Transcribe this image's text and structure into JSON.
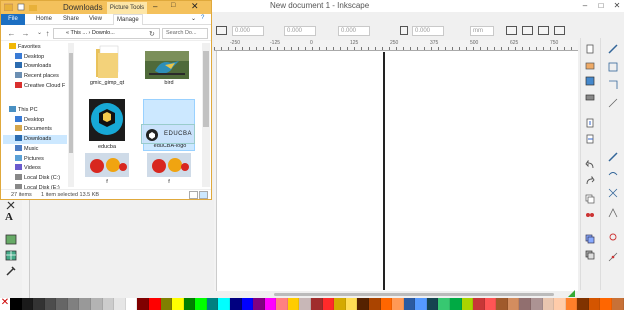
{
  "inkscape": {
    "title": "New document 1 - Inkscape",
    "window_controls": [
      "–",
      "□",
      "✕"
    ],
    "toolbar": {
      "x_value": "0.000",
      "y_value": "0.000",
      "w_value": "0.000",
      "h_value": "0.000",
      "unit": "mm"
    },
    "ruler_labels": [
      "-250",
      "-125",
      "0",
      "125",
      "250",
      "375",
      "500",
      "625",
      "750",
      "875"
    ]
  },
  "explorer": {
    "title": "Downloads",
    "context_tab": "Picture Tools",
    "ribbon_tabs": {
      "file": "File",
      "home": "Home",
      "share": "Share",
      "view": "View",
      "manage": "Manage"
    },
    "address": "« This ... › Downlo...",
    "search_placeholder": "Search Do...",
    "nav_items": [
      {
        "label": "Favorites",
        "icon": "star-icon"
      },
      {
        "label": "Desktop",
        "icon": "desktop-icon"
      },
      {
        "label": "Downloads",
        "icon": "downloads-icon"
      },
      {
        "label": "Recent places",
        "icon": "recent-icon"
      },
      {
        "label": "Creative Cloud F",
        "icon": "creative-cloud-icon"
      },
      {
        "label": "This PC",
        "icon": "computer-icon"
      },
      {
        "label": "Desktop",
        "icon": "desktop-icon"
      },
      {
        "label": "Documents",
        "icon": "documents-icon"
      },
      {
        "label": "Downloads",
        "icon": "downloads-icon"
      },
      {
        "label": "Music",
        "icon": "music-icon"
      },
      {
        "label": "Pictures",
        "icon": "pictures-icon"
      },
      {
        "label": "Videos",
        "icon": "videos-icon"
      },
      {
        "label": "Local Disk (C:)",
        "icon": "drive-icon"
      },
      {
        "label": "Local Disk (E:)",
        "icon": "drive-icon"
      }
    ],
    "files": [
      {
        "name": "gmic_gimp_qt",
        "kind": "folder"
      },
      {
        "name": "bird",
        "kind": "image"
      },
      {
        "name": "educba",
        "kind": "image"
      },
      {
        "name": "eduCBA-logo",
        "kind": "image"
      },
      {
        "name": "f",
        "kind": "image"
      },
      {
        "name": "f",
        "kind": "image"
      }
    ],
    "drag_label": "EDUCBA",
    "status": {
      "count": "27 items",
      "selected": "1 item selected  13.5 KB"
    }
  },
  "palette": [
    "#000000",
    "#1a1a1a",
    "#333333",
    "#4d4d4d",
    "#666666",
    "#808080",
    "#999999",
    "#b3b3b3",
    "#cccccc",
    "#e6e6e6",
    "#ffffff",
    "#800000",
    "#ff0000",
    "#808000",
    "#ffff00",
    "#008000",
    "#00ff00",
    "#008080",
    "#00ffff",
    "#000080",
    "#0000ff",
    "#800080",
    "#ff00ff",
    "#ff8080",
    "#ffcc00",
    "#c8b7b7",
    "#a02c2c",
    "#ff2a2a",
    "#d4aa00",
    "#ffdd55",
    "#552200",
    "#aa4400",
    "#ff6600",
    "#ff9955",
    "#2c5aa0",
    "#5599ff",
    "#164450",
    "#37c871",
    "#00aa44",
    "#aad400",
    "#c83737",
    "#ff5555",
    "#a05a2c",
    "#d38d5f",
    "#916f6f",
    "#ac9393",
    "#e9c6af",
    "#ffccaa",
    "#ff7f2a",
    "#803300",
    "#d45500",
    "#ff6600",
    "#c87137"
  ],
  "colors": {
    "explorer_title": "#f4c15c",
    "selection": "#cce8ff",
    "file_tab": "#1c6fc2"
  }
}
